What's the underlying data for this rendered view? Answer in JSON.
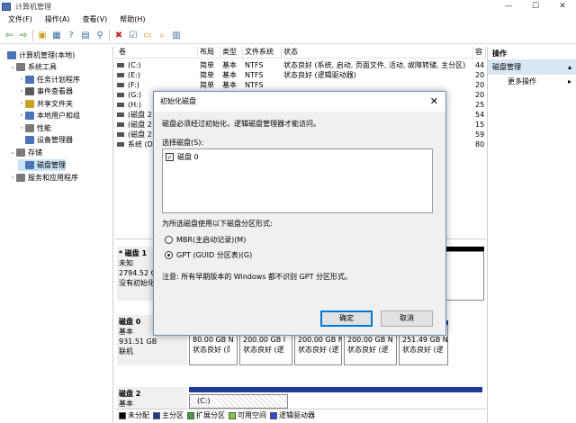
{
  "window": {
    "title": "计算机管理",
    "controls": [
      "—",
      "☐",
      "✕"
    ]
  },
  "menu": [
    "文件(F)",
    "操作(A)",
    "查看(V)",
    "帮助(H)"
  ],
  "toolbar": {
    "icons": [
      {
        "name": "back-arrow-icon",
        "glyph": "⇦",
        "color": "#2e7d32"
      },
      {
        "name": "forward-arrow-icon",
        "glyph": "⇨",
        "color": "#2e7d32"
      },
      {
        "name": "up-folder-icon",
        "glyph": "▣",
        "color": "#c9a227"
      },
      {
        "name": "properties-icon",
        "glyph": "▦",
        "color": "#3a6ea5"
      },
      {
        "name": "help-icon",
        "glyph": "?",
        "color": "#3a6ea5"
      },
      {
        "name": "console-icon",
        "glyph": "▤",
        "color": "#3a6ea5"
      },
      {
        "name": "connect-icon",
        "glyph": "⚲",
        "color": "#3a6ea5"
      },
      {
        "name": "delete-icon",
        "glyph": "✖",
        "color": "#c62828"
      },
      {
        "name": "check-icon",
        "glyph": "☑",
        "color": "#3a6ea5"
      },
      {
        "name": "open-icon",
        "glyph": "▭",
        "color": "#c9a227"
      },
      {
        "name": "search-icon",
        "glyph": "⌕",
        "color": "#c9a227"
      },
      {
        "name": "format-icon",
        "glyph": "▥",
        "color": "#3a6ea5"
      }
    ]
  },
  "tree": [
    {
      "label": "计算机管理(本地)",
      "level": 0,
      "expander": "",
      "color": "#4a74b8"
    },
    {
      "label": "系统工具",
      "level": 1,
      "expander": "⌄",
      "color": "#7a7a7a"
    },
    {
      "label": "任务计划程序",
      "level": 2,
      "expander": "›",
      "color": "#4a74b8"
    },
    {
      "label": "事件查看器",
      "level": 2,
      "expander": "›",
      "color": "#5a5a5a"
    },
    {
      "label": "共享文件夹",
      "level": 2,
      "expander": "›",
      "color": "#c9a227"
    },
    {
      "label": "本地用户和组",
      "level": 2,
      "expander": "›",
      "color": "#4a74b8"
    },
    {
      "label": "性能",
      "level": 2,
      "expander": "›",
      "color": "#7a7a7a"
    },
    {
      "label": "设备管理器",
      "level": 2,
      "expander": "",
      "color": "#4a74b8"
    },
    {
      "label": "存储",
      "level": 1,
      "expander": "⌄",
      "color": "#7a7a7a"
    },
    {
      "label": "磁盘管理",
      "level": 2,
      "expander": "",
      "color": "#4a74b8",
      "selected": true
    },
    {
      "label": "服务和应用程序",
      "level": 1,
      "expander": "›",
      "color": "#7a7a7a"
    }
  ],
  "volumes": {
    "headers": [
      "卷",
      "布局",
      "类型",
      "文件系统",
      "状态",
      "容"
    ],
    "rows": [
      [
        "(C:)",
        "简单",
        "基本",
        "NTFS",
        "状态良好 (系统, 启动, 页面文件, 活动, 故障转储, 主分区)",
        "44"
      ],
      [
        "(E:)",
        "简单",
        "基本",
        "NTFS",
        "状态良好 (逻辑驱动器)",
        "20"
      ],
      [
        "(F:)",
        "简单",
        "基本",
        "NTFS",
        "",
        "20"
      ],
      [
        "(G:)",
        "",
        "",
        "",
        "",
        "20"
      ],
      [
        "(H:)",
        "",
        "",
        "",
        "",
        "25"
      ],
      [
        "(磁盘 2",
        "",
        "",
        "",
        "",
        "54"
      ],
      [
        "(磁盘 2",
        "",
        "",
        "",
        "",
        "15"
      ],
      [
        "(磁盘 2",
        "",
        "",
        "",
        "",
        "59"
      ],
      [
        "系统 (D:",
        "",
        "",
        "",
        "",
        "80"
      ]
    ]
  },
  "actions": {
    "header": "操作",
    "selected": "磁盘管理",
    "more": "更多操作"
  },
  "disks": [
    {
      "name": "磁盘 1",
      "prefix": "*",
      "type": "未知",
      "size": "2794.52 GB",
      "status": "没有初始化"
    },
    {
      "name": "磁盘 0",
      "prefix": "",
      "type": "基本",
      "size": "931.51 GB",
      "status": "联机"
    },
    {
      "name": "磁盘 2",
      "prefix": "",
      "type": "基本",
      "size": "",
      "status": ""
    }
  ],
  "partitions": [
    {
      "letter": "(",
      "size": "80.00 GB N",
      "status": "状态良好 (阝"
    },
    {
      "letter": "(",
      "size": "200.00 GB I",
      "status": "状态良好 (逻"
    },
    {
      "letter": "(",
      "size": "200.00 GB N",
      "status": "状态良好 (逻"
    },
    {
      "letter": "(",
      "size": "200.00 GB N",
      "status": "状态良好 (逻"
    },
    {
      "letter": "(",
      "size": "251.49 GB N",
      "status": "状态良好 (逻"
    }
  ],
  "disk2_partition": "(C:)",
  "legend": [
    {
      "label": "未分配",
      "color": "#000000"
    },
    {
      "label": "主分区",
      "color": "#1f3b9a"
    },
    {
      "label": "扩展分区",
      "color": "#3fa03f"
    },
    {
      "label": "可用空间",
      "color": "#7ac943"
    },
    {
      "label": "逻辑驱动器",
      "color": "#2d49d6"
    }
  ],
  "dialog": {
    "title": "初始化磁盘",
    "close": "✕",
    "message": "磁盘必须经过初始化，逻辑磁盘管理器才能访问。",
    "select_label": "选择磁盘(S):",
    "disk_item": "磁盘 0",
    "disk_checked": "✓",
    "partition_label": "为所选磁盘使用以下磁盘分区形式:",
    "option_mbr": "MBR(主启动记录)(M)",
    "option_gpt": "GPT (GUID 分区表)(G)",
    "selected_option": "gpt",
    "note": "注意: 所有早期版本的 Windows 都不识别 GPT 分区形式。",
    "ok": "确定",
    "cancel": "取消"
  }
}
